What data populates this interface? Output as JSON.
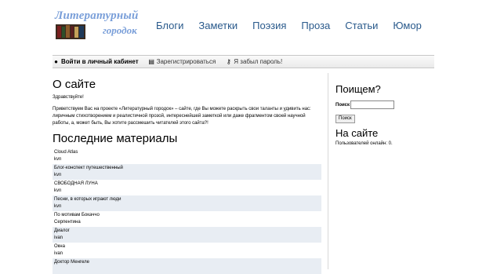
{
  "logo": {
    "line1": "Литературный",
    "line2": "городок"
  },
  "nav": [
    "Блоги",
    "Заметки",
    "Поэзия",
    "Проза",
    "Статьи",
    "Юмор"
  ],
  "userbar": {
    "login": "Войти в личный кабинет",
    "register": "Зарегистрироваться",
    "forgot": "Я забыл пароль!"
  },
  "main": {
    "about_title": "О сайте",
    "greeting": "Здравствуйте!",
    "intro": "Приветствуем Вас на проекте «Литературный городок» – сайте, где Вы можете раскрыть свои таланты и удивить нас: лиричным стихотворением и реалистичной прозой, интереснейшей заметкой или даже фрагментом своей научной работы, а, может быть, Вы хотите рассмешить читателей этого сайта?!",
    "latest_title": "Последние материалы",
    "items": [
      {
        "title": "Cloud Atlas",
        "author": "kvn"
      },
      {
        "title": "Блог-конспект путешественный",
        "author": "kvn"
      },
      {
        "title": "СВОБОДНАЯ ЛУНА",
        "author": "kvn"
      },
      {
        "title": "Песни, в которых играют люди",
        "author": "kvn"
      },
      {
        "title": "По мотивам Бокаччо",
        "author": "Серпентина"
      },
      {
        "title": "Диалог",
        "author": "ivan"
      },
      {
        "title": "Окна",
        "author": "ivan"
      },
      {
        "title": "Доктор Менгеле",
        "author": ""
      }
    ]
  },
  "sidebar": {
    "search_title": "Поищем?",
    "search_label": "Поиск",
    "search_value": "",
    "search_button": "Поиск",
    "online_title": "На сайте",
    "online_text": "Пользователей онлайн: 0."
  },
  "colors": {
    "logo": "#7a9fd9",
    "nav": "#2a5a8c",
    "row_alt": "#e8edf3"
  }
}
